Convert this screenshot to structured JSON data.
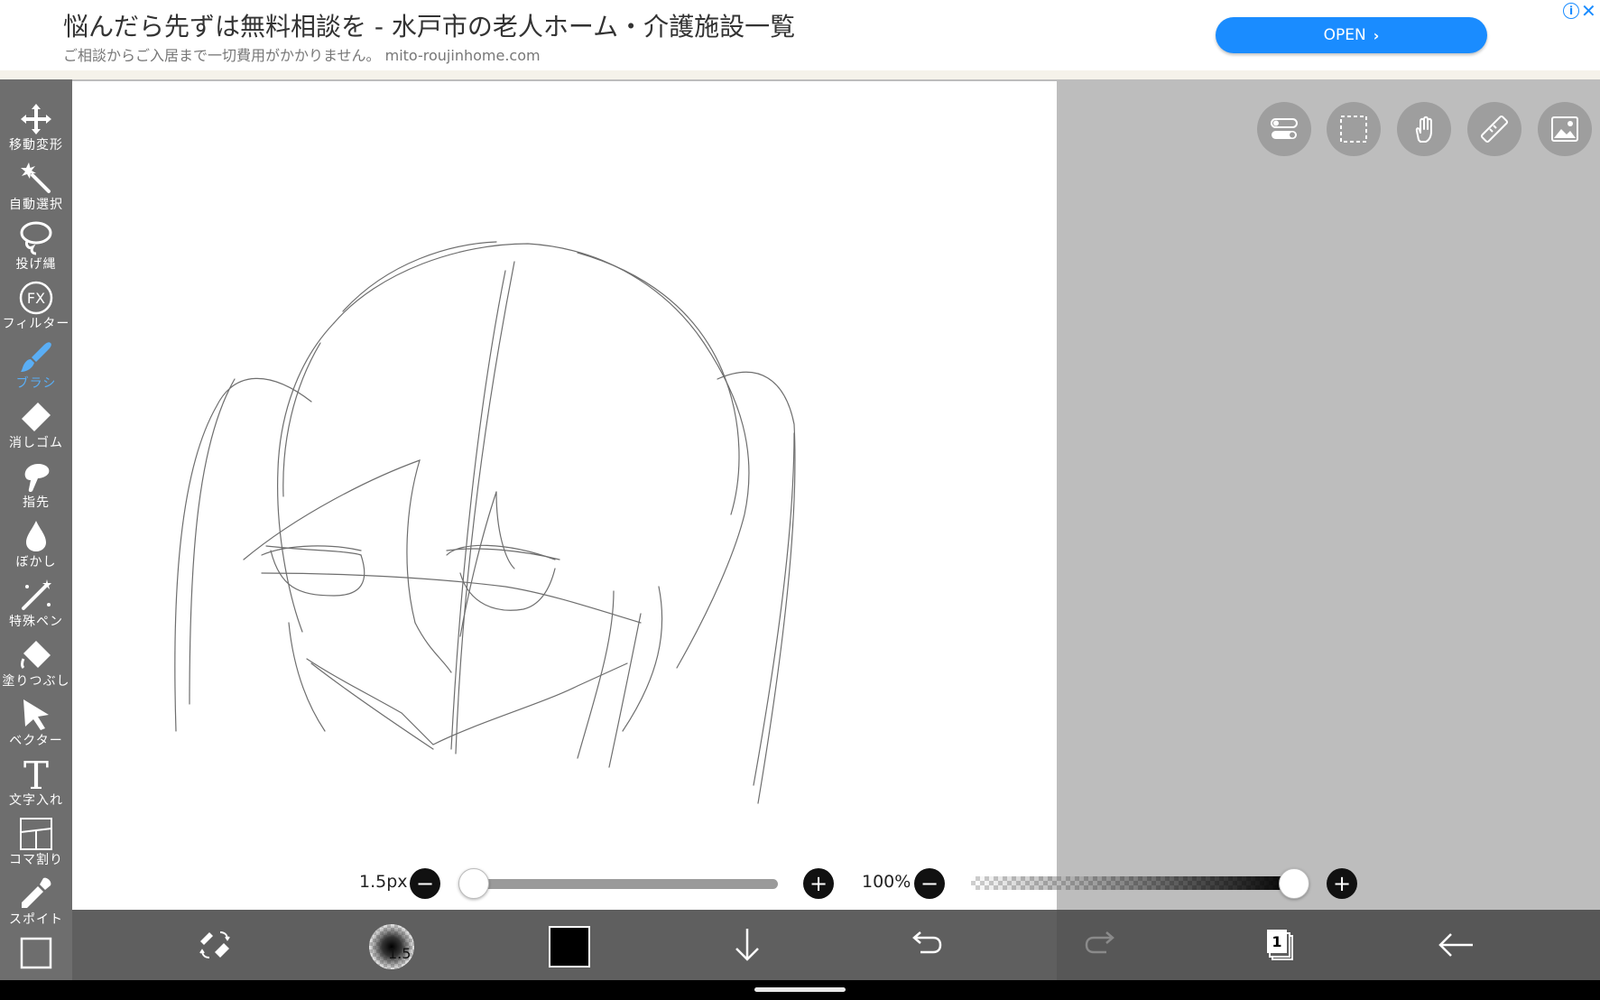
{
  "ad": {
    "title": "悩んだら先ずは無料相談を - 水戸市の老人ホーム・介護施設一覧",
    "subtitle": "ご相談からご入居まで一切費用がかかりません。 mito-roujinhome.com",
    "button_label": "OPEN",
    "info_icon": "i",
    "close_icon": "✕"
  },
  "toolbar": {
    "tools": [
      {
        "label": "移動変形",
        "icon": "move-icon"
      },
      {
        "label": "自動選択",
        "icon": "magic-wand-icon"
      },
      {
        "label": "投げ縄",
        "icon": "lasso-icon"
      },
      {
        "label": "フィルター",
        "icon": "fx-icon",
        "icon_text": "FX"
      },
      {
        "label": "ブラシ",
        "icon": "brush-icon",
        "active": true
      },
      {
        "label": "消しゴム",
        "icon": "eraser-icon"
      },
      {
        "label": "指先",
        "icon": "finger-icon"
      },
      {
        "label": "ぼかし",
        "icon": "blur-drop-icon"
      },
      {
        "label": "特殊ペン",
        "icon": "special-pen-icon"
      },
      {
        "label": "塗りつぶし",
        "icon": "fill-bucket-icon"
      },
      {
        "label": "ベクター",
        "icon": "vector-icon"
      },
      {
        "label": "文字入れ",
        "icon": "text-icon",
        "icon_text": "T"
      },
      {
        "label": "コマ割り",
        "icon": "frame-divide-icon"
      },
      {
        "label": "スポイト",
        "icon": "eyedropper-icon"
      }
    ]
  },
  "top_buttons": [
    "toggle-icon",
    "selection-icon",
    "hand-icon",
    "ruler-icon",
    "image-icon"
  ],
  "brush": {
    "size_label": "1.5px",
    "size_fraction": 0.0,
    "opacity_label": "100%",
    "opacity_fraction": 1.0,
    "minus": "−",
    "plus": "+"
  },
  "bottom_bar": {
    "brush_size_badge": "1.5",
    "color": "#000000",
    "layer_count": "1"
  },
  "colors": {
    "accent": "#1a8cff",
    "active_tool": "#5aaef5",
    "toolbar_bg": "#6e6e6e",
    "bottom_bar_bg": "#5f5f5f"
  }
}
